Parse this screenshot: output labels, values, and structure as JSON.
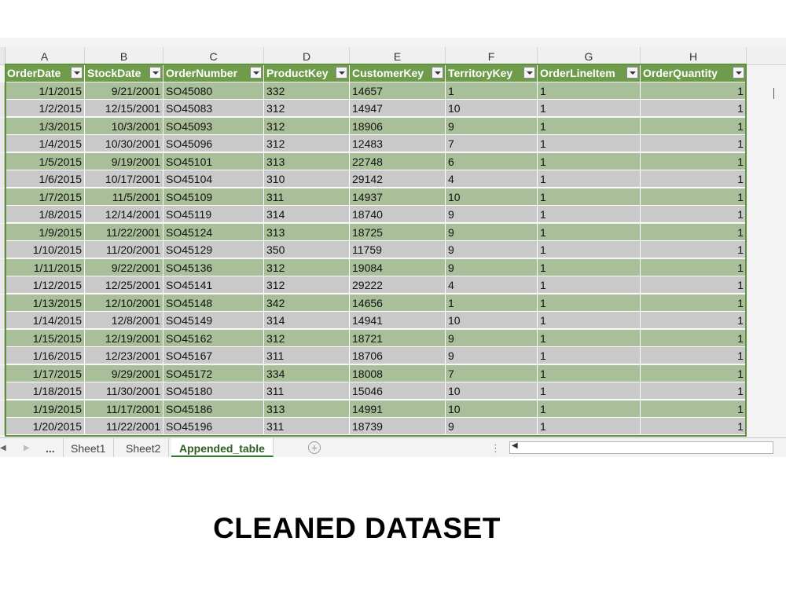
{
  "columns": [
    "A",
    "B",
    "C",
    "D",
    "E",
    "F",
    "G",
    "H"
  ],
  "headers": [
    "OrderDate",
    "StockDate",
    "OrderNumber",
    "ProductKey",
    "CustomerKey",
    "TerritoryKey",
    "OrderLineItem",
    "OrderQuantity"
  ],
  "rows": [
    [
      "1/1/2015",
      "9/21/2001",
      "SO45080",
      "332",
      "14657",
      "1",
      "1",
      "1"
    ],
    [
      "1/2/2015",
      "12/15/2001",
      "SO45083",
      "312",
      "14947",
      "10",
      "1",
      "1"
    ],
    [
      "1/3/2015",
      "10/3/2001",
      "SO45093",
      "312",
      "18906",
      "9",
      "1",
      "1"
    ],
    [
      "1/4/2015",
      "10/30/2001",
      "SO45096",
      "312",
      "12483",
      "7",
      "1",
      "1"
    ],
    [
      "1/5/2015",
      "9/19/2001",
      "SO45101",
      "313",
      "22748",
      "6",
      "1",
      "1"
    ],
    [
      "1/6/2015",
      "10/17/2001",
      "SO45104",
      "310",
      "29142",
      "4",
      "1",
      "1"
    ],
    [
      "1/7/2015",
      "11/5/2001",
      "SO45109",
      "311",
      "14937",
      "10",
      "1",
      "1"
    ],
    [
      "1/8/2015",
      "12/14/2001",
      "SO45119",
      "314",
      "18740",
      "9",
      "1",
      "1"
    ],
    [
      "1/9/2015",
      "11/22/2001",
      "SO45124",
      "313",
      "18725",
      "9",
      "1",
      "1"
    ],
    [
      "1/10/2015",
      "11/20/2001",
      "SO45129",
      "350",
      "11759",
      "9",
      "1",
      "1"
    ],
    [
      "1/11/2015",
      "9/22/2001",
      "SO45136",
      "312",
      "19084",
      "9",
      "1",
      "1"
    ],
    [
      "1/12/2015",
      "12/25/2001",
      "SO45141",
      "312",
      "29222",
      "4",
      "1",
      "1"
    ],
    [
      "1/13/2015",
      "12/10/2001",
      "SO45148",
      "342",
      "14656",
      "1",
      "1",
      "1"
    ],
    [
      "1/14/2015",
      "12/8/2001",
      "SO45149",
      "314",
      "14941",
      "10",
      "1",
      "1"
    ],
    [
      "1/15/2015",
      "12/19/2001",
      "SO45162",
      "312",
      "18721",
      "9",
      "1",
      "1"
    ],
    [
      "1/16/2015",
      "12/23/2001",
      "SO45167",
      "311",
      "18706",
      "9",
      "1",
      "1"
    ],
    [
      "1/17/2015",
      "9/29/2001",
      "SO45172",
      "334",
      "18008",
      "7",
      "1",
      "1"
    ],
    [
      "1/18/2015",
      "11/30/2001",
      "SO45180",
      "311",
      "15046",
      "10",
      "1",
      "1"
    ],
    [
      "1/19/2015",
      "11/17/2001",
      "SO45186",
      "313",
      "14991",
      "10",
      "1",
      "1"
    ],
    [
      "1/20/2015",
      "11/22/2001",
      "SO45196",
      "311",
      "18739",
      "9",
      "1",
      "1"
    ]
  ],
  "tabs": {
    "ellipsis": "...",
    "items": [
      "Sheet1",
      "Sheet2",
      "Appended_table"
    ],
    "active": "Appended_table",
    "add": "+"
  },
  "caption": "CLEANED DATASET",
  "colors": {
    "header_green": "#6e9c4a",
    "row_green": "#a9bf99",
    "row_gray": "#c9c9c9",
    "frame": "#5e8f3f"
  }
}
